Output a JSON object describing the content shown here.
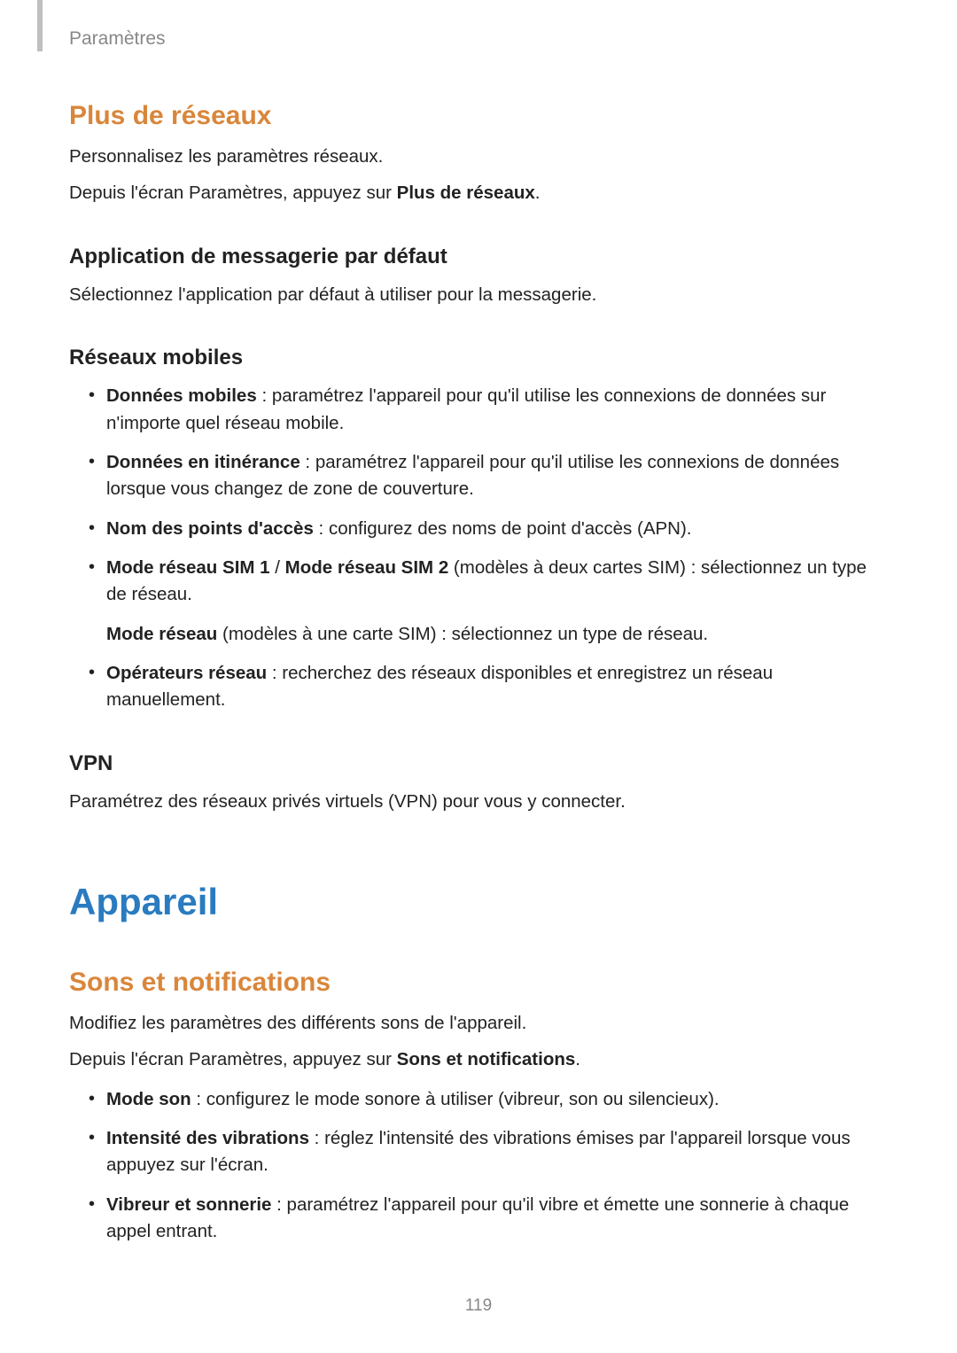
{
  "breadcrumb": "Paramètres",
  "section_more_networks": {
    "title": "Plus de réseaux",
    "intro1": "Personnalisez les paramètres réseaux.",
    "intro2_prefix": "Depuis l'écran Paramètres, appuyez sur ",
    "intro2_bold": "Plus de réseaux",
    "intro2_suffix": ".",
    "default_msg_app": {
      "title": "Application de messagerie par défaut",
      "body": "Sélectionnez l'application par défaut à utiliser pour la messagerie."
    },
    "mobile_networks": {
      "title": "Réseaux mobiles",
      "items": [
        {
          "bold": "Données mobiles",
          "rest": " : paramétrez l'appareil pour qu'il utilise les connexions de données sur n'importe quel réseau mobile."
        },
        {
          "bold": "Données en itinérance",
          "rest": " : paramétrez l'appareil pour qu'il utilise les connexions de données lorsque vous changez de zone de couverture."
        },
        {
          "bold": "Nom des points d'accès",
          "rest": " : configurez des noms de point d'accès (APN)."
        },
        {
          "bold": "Mode réseau SIM 1",
          "mid": " / ",
          "bold2": "Mode réseau SIM 2",
          "rest": " (modèles à deux cartes SIM) : sélectionnez un type de réseau.",
          "sub_bold": "Mode réseau",
          "sub_rest": " (modèles à une carte SIM) : sélectionnez un type de réseau."
        },
        {
          "bold": "Opérateurs réseau",
          "rest": " : recherchez des réseaux disponibles et enregistrez un réseau manuellement."
        }
      ]
    },
    "vpn": {
      "title": "VPN",
      "body": "Paramétrez des réseaux privés virtuels (VPN) pour vous y connecter."
    }
  },
  "section_device": {
    "title": "Appareil",
    "sounds": {
      "title": "Sons et notifications",
      "intro1": "Modifiez les paramètres des différents sons de l'appareil.",
      "intro2_prefix": "Depuis l'écran Paramètres, appuyez sur ",
      "intro2_bold": "Sons et notifications",
      "intro2_suffix": ".",
      "items": [
        {
          "bold": "Mode son",
          "rest": " : configurez le mode sonore à utiliser (vibreur, son ou silencieux)."
        },
        {
          "bold": "Intensité des vibrations",
          "rest": " : réglez l'intensité des vibrations émises par l'appareil lorsque vous appuyez sur l'écran."
        },
        {
          "bold": "Vibreur et sonnerie",
          "rest": " : paramétrez l'appareil pour qu'il vibre et émette une sonnerie à chaque appel entrant."
        }
      ]
    }
  },
  "page_number": "119"
}
